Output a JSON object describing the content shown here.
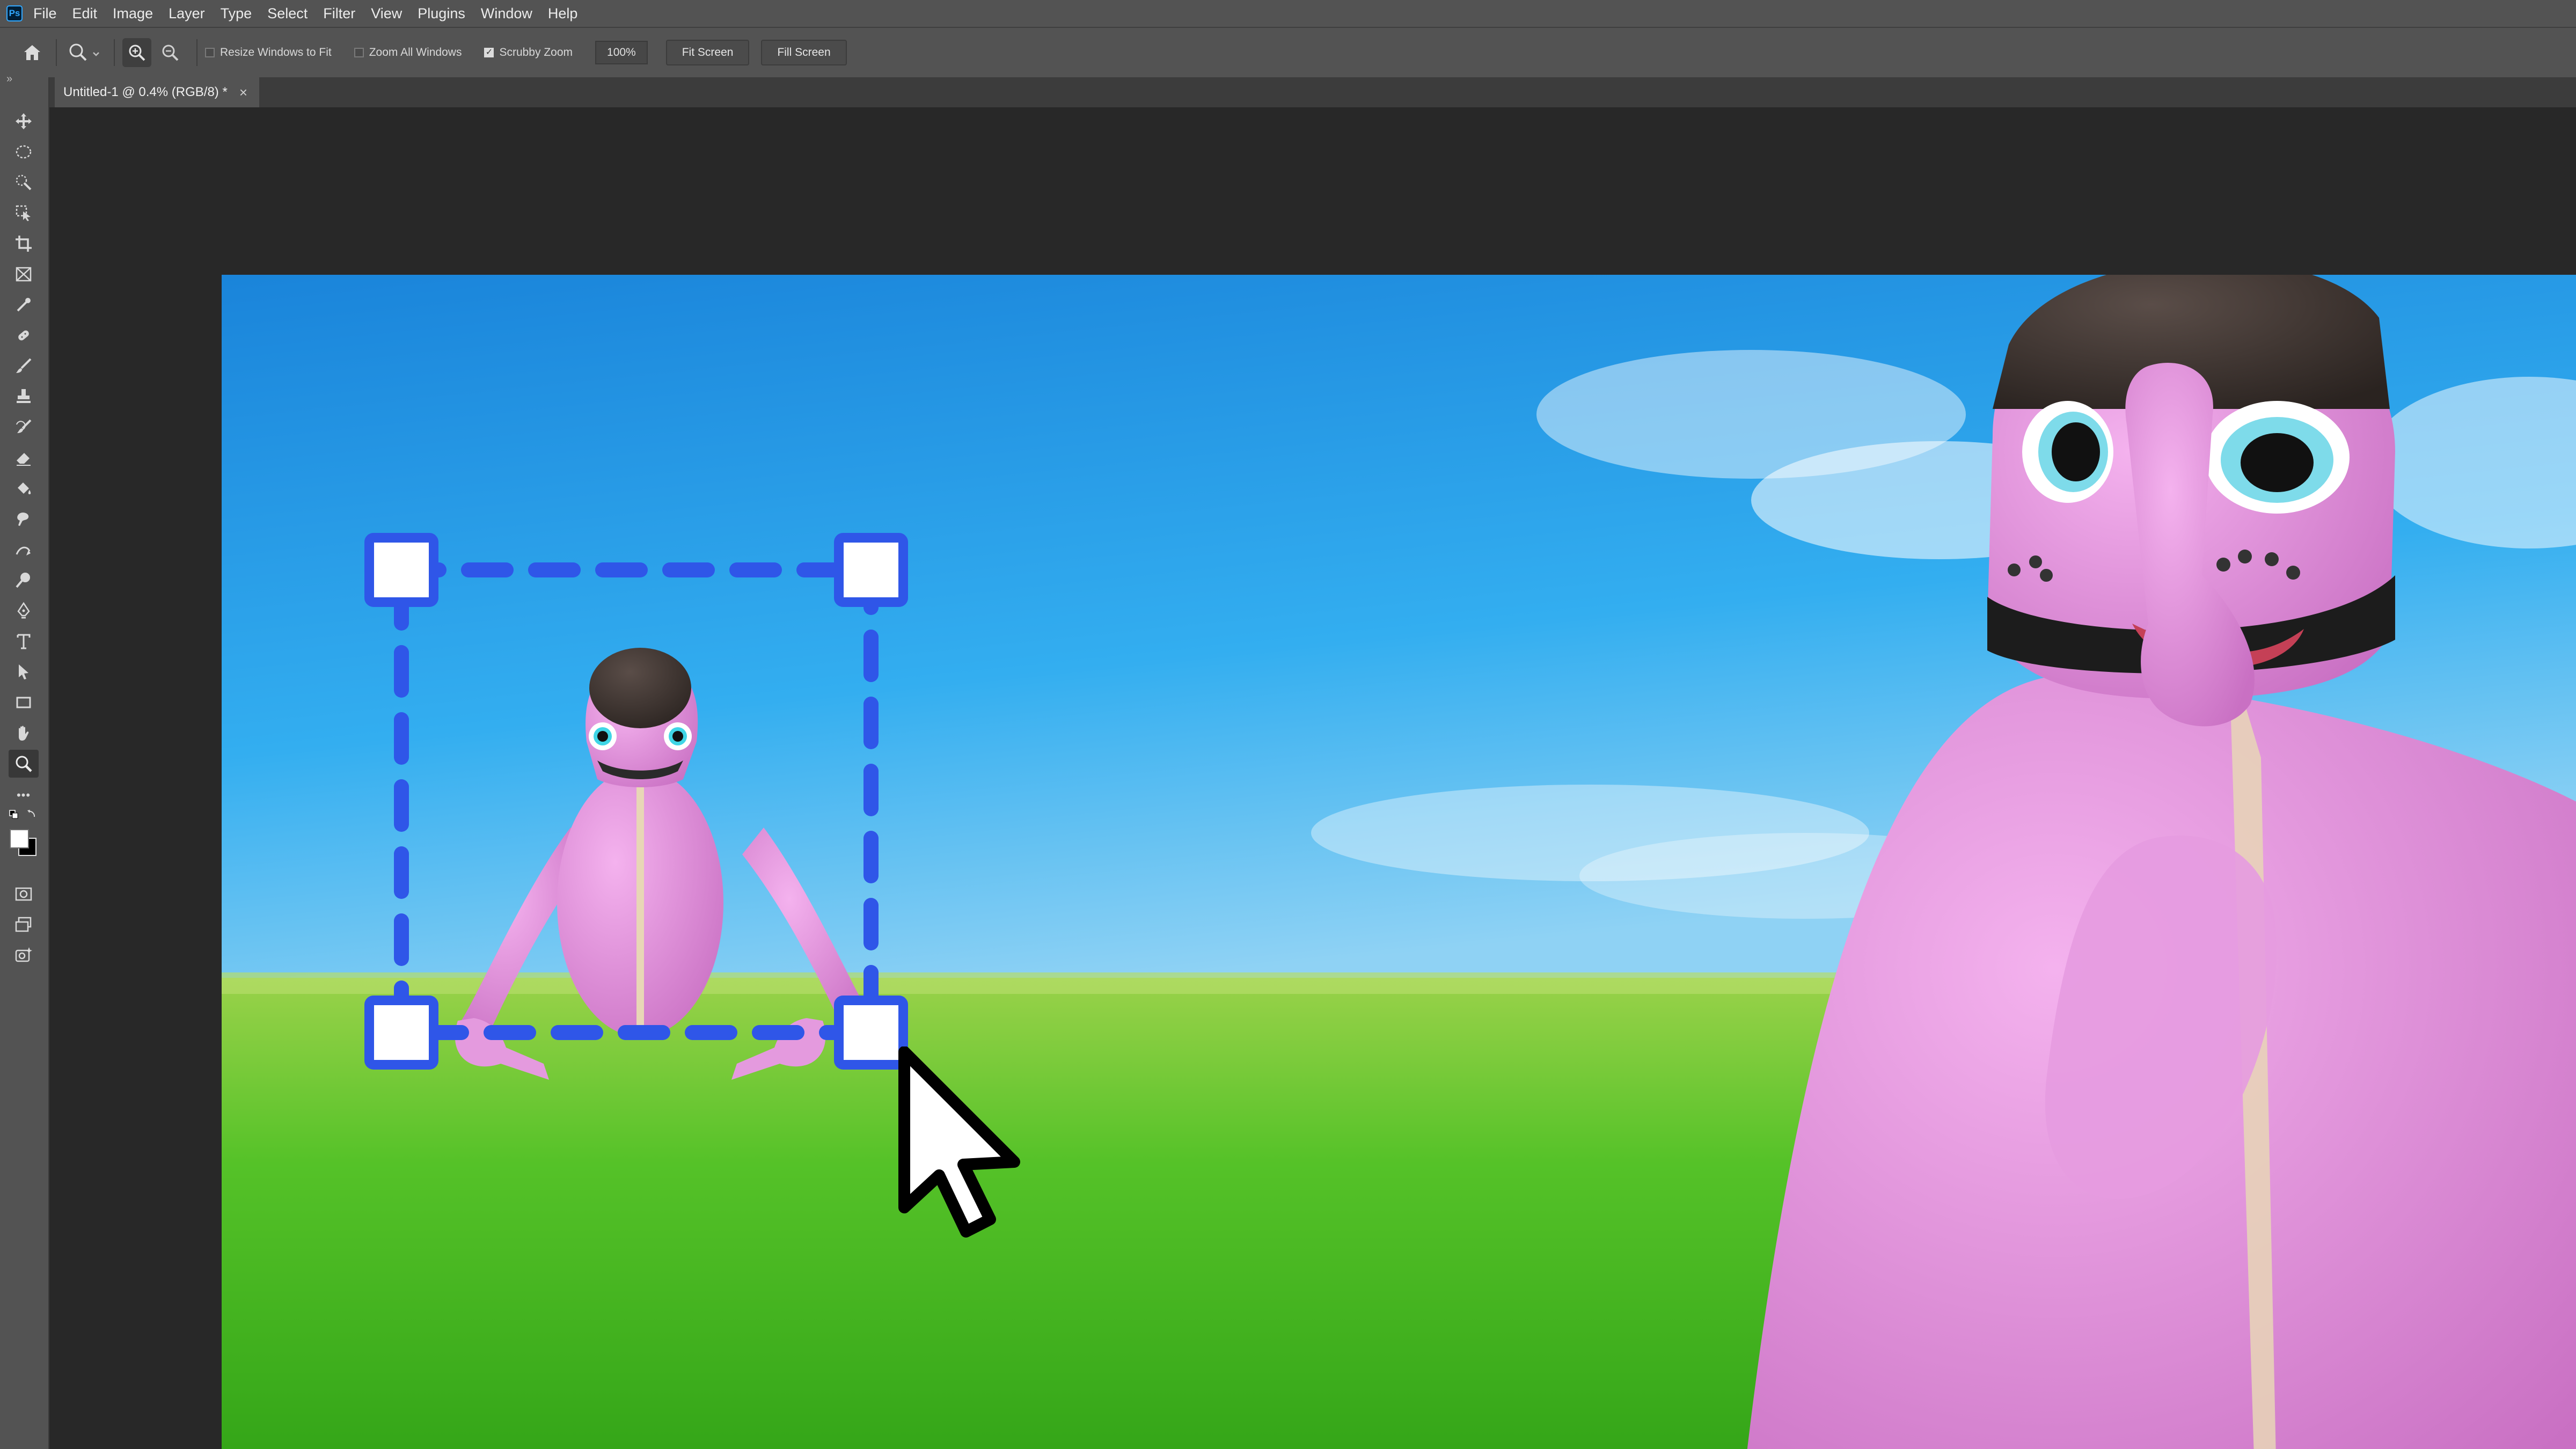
{
  "app": {
    "logo_text": "Ps"
  },
  "menubar": {
    "items": [
      "File",
      "Edit",
      "Image",
      "Layer",
      "Type",
      "Select",
      "Filter",
      "View",
      "Plugins",
      "Window",
      "Help"
    ]
  },
  "options": {
    "resize_windows_label": "Resize Windows to Fit",
    "resize_windows_checked": false,
    "zoom_all_label": "Zoom All Windows",
    "zoom_all_checked": false,
    "scrubby_label": "Scrubby Zoom",
    "scrubby_checked": true,
    "zoom_value": "100%",
    "fit_screen_label": "Fit Screen",
    "fill_screen_label": "Fill Screen"
  },
  "document_tab": {
    "title": "Untitled-1 @ 0.4% (RGB/8) *",
    "close": "×"
  },
  "toolbar": {
    "collapse": "»",
    "edit_toolbar": "•••"
  },
  "colors": {
    "accent_selection": "#2f56e8",
    "handle_fill": "#ffffff",
    "character_pink": "#e597e0",
    "sky_top": "#1e8fe0",
    "grass": "#58c42a"
  }
}
